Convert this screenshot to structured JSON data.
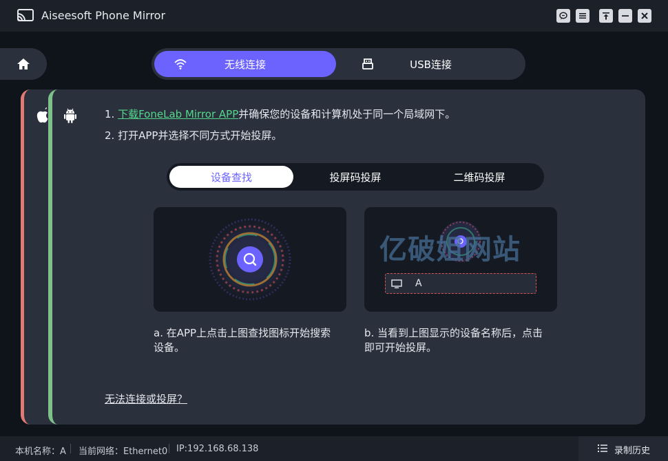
{
  "app": {
    "title": "Aiseesoft Phone Mirror"
  },
  "window_buttons": [
    "feedback-icon",
    "menu-icon",
    "pin-icon",
    "minimize-icon",
    "close-icon"
  ],
  "connection_tabs": [
    {
      "label": "无线连接",
      "icon": "wifi-icon",
      "active": true
    },
    {
      "label": "USB连接",
      "icon": "usb-icon",
      "active": false
    }
  ],
  "device_tabs": [
    {
      "icon": "apple-icon",
      "color": "#e07a74"
    },
    {
      "icon": "android-icon",
      "color": "#7ec08a",
      "active": true
    }
  ],
  "instructions": {
    "step1_prefix": "1. ",
    "step1_link": "下载FoneLab Mirror APP",
    "step1_suffix": "并确保您的设备和计算机处于同一个局域网下。",
    "step2": "2. 打开APP并选择不同方式开始投屏。"
  },
  "mode_tabs": [
    {
      "label": "设备查找",
      "active": true
    },
    {
      "label": "投屏码投屏",
      "active": false
    },
    {
      "label": "二维码投屏",
      "active": false
    }
  ],
  "card_a": {
    "caption_line1": "a. 在APP上点击上图查找图标开始搜索",
    "caption_line2": "设备。"
  },
  "card_b": {
    "caption_line1": "b. 当看到上图显示的设备名称后，点击",
    "caption_line2": "即可开始投屏。",
    "device_name": "A",
    "watermark": "亿破姐网站"
  },
  "help_link": "无法连接或投屏？",
  "status": {
    "machine_name": "本机名称：A",
    "network": "当前网络：Ethernet0",
    "ip": "IP:192.168.68.138",
    "history_label": "录制历史"
  },
  "colors": {
    "accent": "#6c63ff",
    "link": "#54d98c",
    "ios_strip": "#e07a74",
    "android_strip": "#7ec08a"
  }
}
